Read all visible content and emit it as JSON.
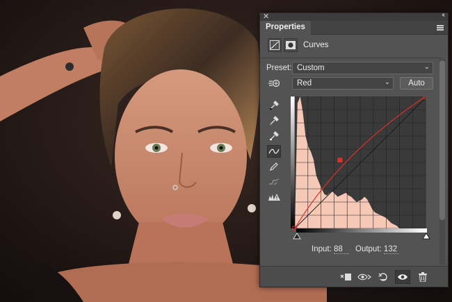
{
  "panel": {
    "tab_label": "Properties",
    "adjustment_title": "Curves",
    "preset_label": "Preset:",
    "preset_value": "Custom",
    "channel_value": "Red",
    "auto_label": "Auto",
    "input_label": "Input:",
    "input_value": "88",
    "output_label": "Output:",
    "output_value": "132"
  },
  "curve": {
    "channel_color": "#d9312a",
    "histogram_color": "#f6c8b6",
    "points": [
      [
        0,
        0
      ],
      [
        88,
        132
      ],
      [
        255,
        255
      ]
    ]
  },
  "icons": {
    "close": "close-icon",
    "collapse": "collapse-icon",
    "panel_menu": "panel-menu-icon",
    "curves": "curves-adjustment-icon",
    "mask": "layer-mask-icon",
    "target_adjust": "targeted-adjustment-icon",
    "sample_black": "sample-black-point-icon",
    "sample_gray": "sample-gray-point-icon",
    "sample_white": "sample-white-point-icon",
    "edit_points": "edit-points-icon",
    "draw_pencil": "draw-pencil-icon",
    "smooth": "smooth-curve-icon",
    "clipping_warning": "clipping-warning-icon",
    "clip_to_layer": "clip-to-layer-icon",
    "view_previous": "view-previous-state-icon",
    "reset": "reset-icon",
    "visibility": "visibility-icon",
    "delete": "delete-icon"
  }
}
